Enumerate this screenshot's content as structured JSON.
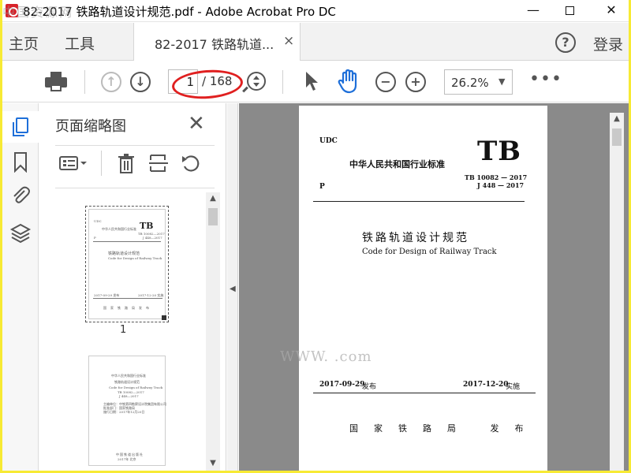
{
  "window": {
    "title": "82-2017 铁路轨道设计规范.pdf - Adobe Acrobat Pro DC",
    "watermark_top_left": "中国资源网",
    "min_label": "—",
    "close_label": "✕"
  },
  "menu": {
    "home": "主页",
    "tools": "工具",
    "tab_label": "82-2017 铁路轨道...",
    "tab_close": "×",
    "help_label": "?",
    "login": "登录"
  },
  "toolbar": {
    "page_current": "1",
    "page_total": "/ 168",
    "zoom": "26.2%",
    "zoom_caret": "▼",
    "prev_glyph": "↑",
    "next_glyph": "↓",
    "zoom_out_glyph": "−",
    "zoom_in_glyph": "+",
    "more_glyph": "•••"
  },
  "panel": {
    "title": "页面缩略图",
    "close": "✕",
    "thumbnail_page_label": "1"
  },
  "thumbnail_1": {
    "udc": "UDC",
    "std": "中华人民共和国行业标准",
    "tb": "TB",
    "code1": "TB 10082—2017",
    "code2": "J 448—2017",
    "p": "P",
    "title_cn": "铁路轨道设计规范",
    "title_en": "Code for Design of Railway Track",
    "date1": "2017-09-29 发布",
    "date2": "2017-12-20 实施",
    "publisher": "国家铁路局发布"
  },
  "thumbnail_2": {
    "line1": "中华人民共和国行业标准",
    "line2": "铁路轨道设计规范",
    "line3": "Code for Design of Railway Track",
    "line4": "TB 10082—2017",
    "line5": "J 448—2017",
    "line6": "主编单位：中铁第四勘察设计院集团有限公司",
    "line7": "批准部门：国家铁路局",
    "line8": "施行日期：2017年12月20日",
    "line9": "中国铁道出版社",
    "line10": "2017年 北京"
  },
  "document_page": {
    "udc": "UDC",
    "standard_name": "中华人民共和国行业标准",
    "tb": "TB",
    "code1": "TB 10082 — 2017",
    "code2": "J 448 — 2017",
    "p": "P",
    "title_cn": "铁路轨道设计规范",
    "title_en": "Code for Design of Railway Track",
    "issue_date": "2017-09-29",
    "issue_label": "发布",
    "effective_date": "2017-12-20",
    "effective_label": "实施",
    "publisher": "国家铁路局  发布"
  },
  "watermark_bottom_right": "WWW.       .com"
}
